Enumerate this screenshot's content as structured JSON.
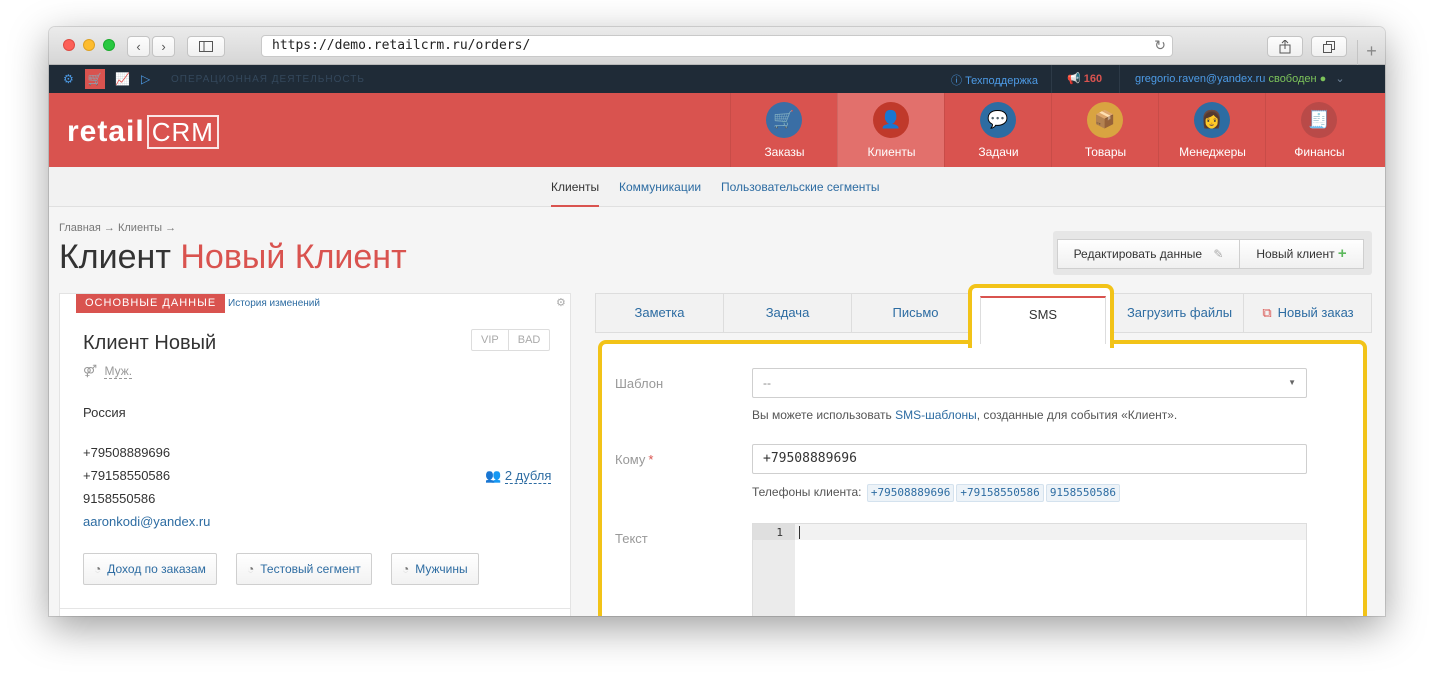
{
  "browser": {
    "url": "https://demo.retailcrm.ru/orders/",
    "back": "‹",
    "forward": "›"
  },
  "topbar": {
    "section": "ОПЕРАЦИОННАЯ ДЕЯТЕЛЬНОСТЬ",
    "support": "Техподдержка",
    "calls_count": "160",
    "user_email": "gregorio.raven@yandex.ru",
    "status": "свободен"
  },
  "header": {
    "logo_text": "retail",
    "logo_crm": "CRM",
    "nav": [
      {
        "label": "Заказы",
        "icon": "cart-icon",
        "color": "#3a6ea5"
      },
      {
        "label": "Клиенты",
        "icon": "person-icon",
        "color": "#c0392b"
      },
      {
        "label": "Задачи",
        "icon": "chat-icon",
        "color": "#2d6ca2"
      },
      {
        "label": "Товары",
        "icon": "box-icon",
        "color": "#d9a441"
      },
      {
        "label": "Менеджеры",
        "icon": "manager-icon",
        "color": "#2d6ca2"
      },
      {
        "label": "Финансы",
        "icon": "register-icon",
        "color": "#b94a48"
      }
    ]
  },
  "subnav": {
    "items": [
      "Клиенты",
      "Коммуникации",
      "Пользовательские сегменты"
    ]
  },
  "page": {
    "breadcrumb": "Главная → Клиенты →",
    "title_prefix": "Клиент",
    "title_name": "Новый Клиент",
    "edit_button": "Редактировать данные",
    "new_client_button": "Новый клиент"
  },
  "client": {
    "tab_main": "ОСНОВНЫЕ ДАННЫЕ",
    "tab_history": "История изменений",
    "name": "Клиент Новый",
    "badges": [
      "VIP",
      "BAD"
    ],
    "gender": "Муж.",
    "country": "Россия",
    "phones": [
      "+79508889696",
      "+79158550586",
      "9158550586"
    ],
    "email": "aaronkodi@yandex.ru",
    "duplicates": "2 дубля",
    "segments": [
      "Доход по заказам",
      "Тестовый сегмент",
      "Мужчины"
    ]
  },
  "actions": {
    "tabs": [
      "Заметка",
      "Задача",
      "Письмо",
      "SMS",
      "Загрузить файлы",
      "Новый заказ"
    ]
  },
  "sms_form": {
    "template_label": "Шаблон",
    "template_value": "--",
    "hint_prefix": "Вы можете использовать ",
    "hint_link": "SMS-шаблоны",
    "hint_suffix": ", созданные для события «Клиент».",
    "to_label": "Кому",
    "to_value": "+79508889696",
    "phones_label": "Телефоны клиента:",
    "phones": [
      "+79508889696",
      "+79158550586",
      "9158550586"
    ],
    "text_label": "Текст",
    "line_number": "1"
  }
}
